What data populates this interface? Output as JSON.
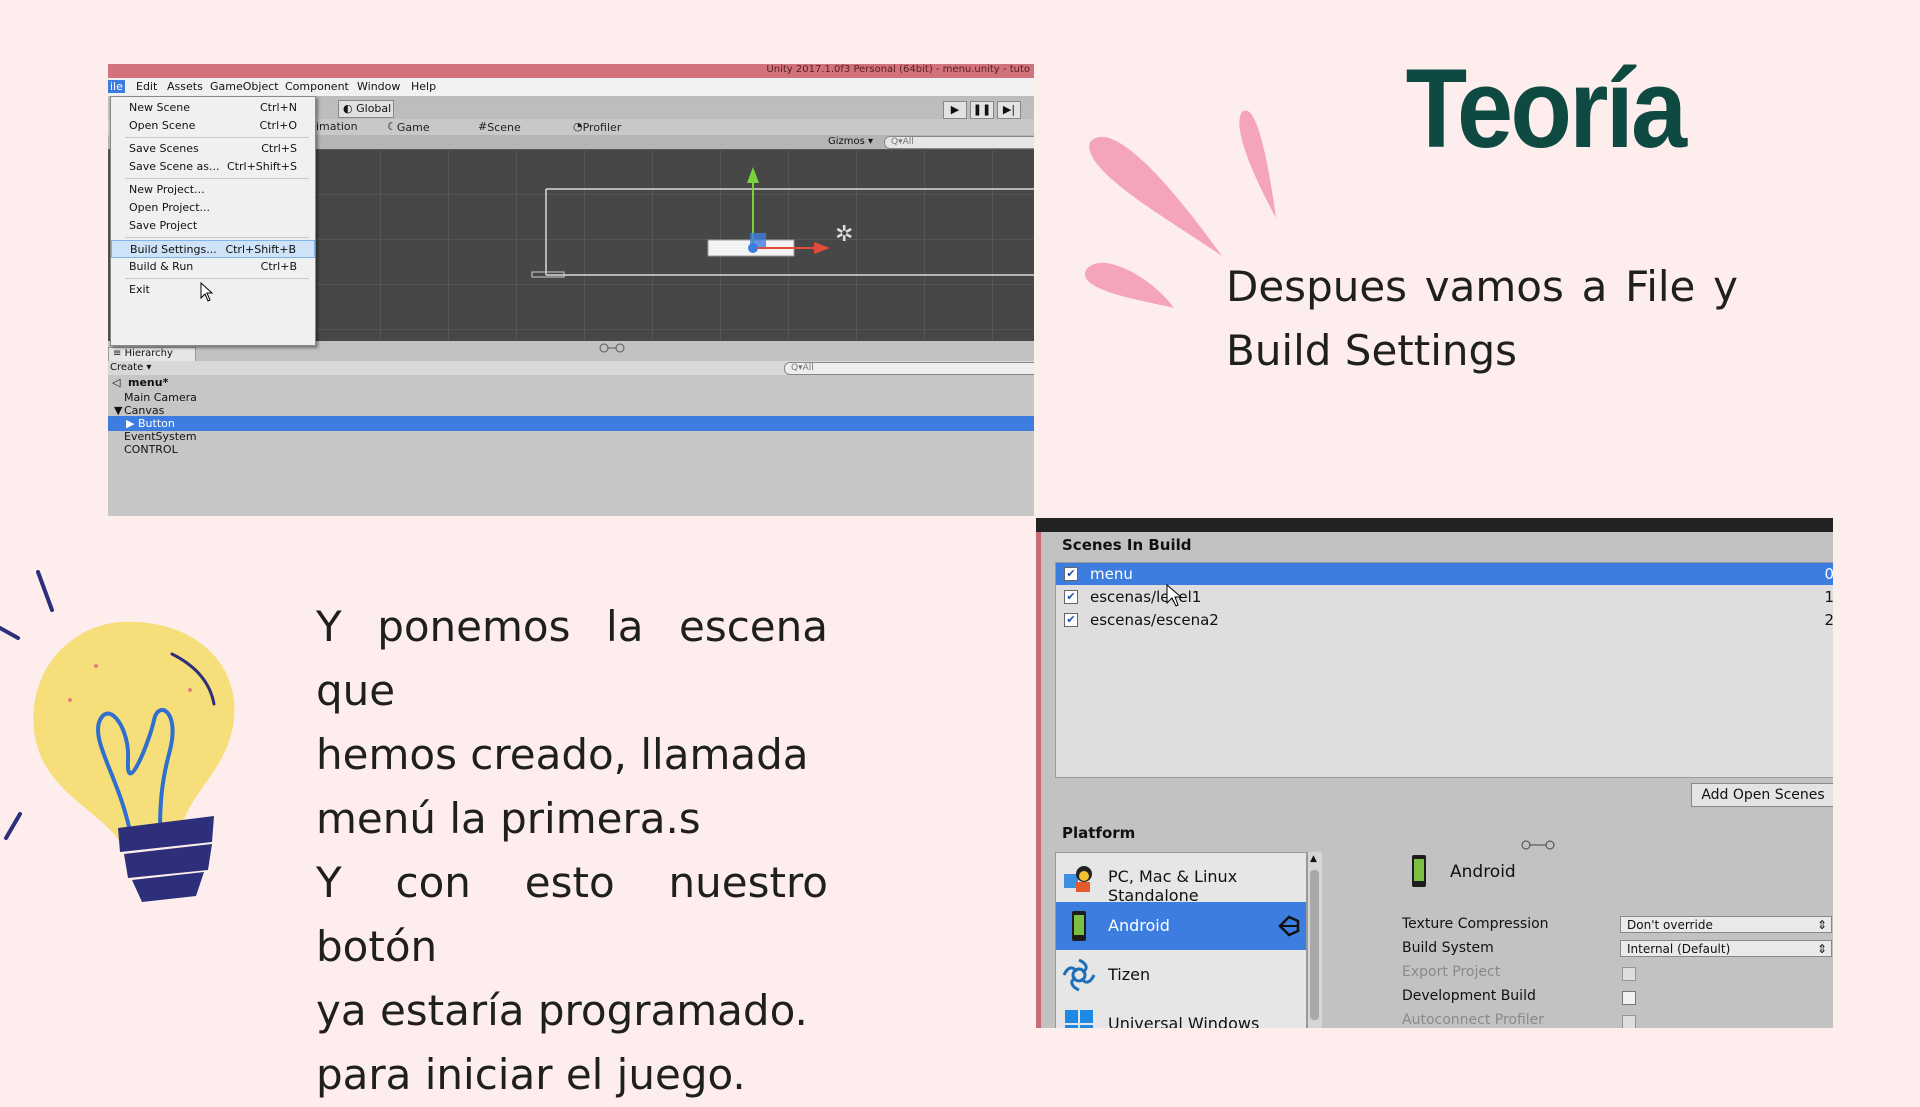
{
  "slide": {
    "title": "Teoría",
    "top_text": "Despues vamos a File y Build Settings",
    "left_lines": [
      "Y ponemos la escena que",
      "hemos creado, llamada",
      "menú la primera.s",
      "Y con esto nuestro botón",
      "ya estaría programado.",
      "para iniciar el juego."
    ]
  },
  "unity": {
    "title": "Unity 2017.1.0f3 Personal (64bit) - menu.unity - tuto",
    "menubar": [
      "ile",
      "Edit",
      "Assets",
      "GameObject",
      "Component",
      "Window",
      "Help"
    ],
    "toolbar_global": "Global",
    "tabs": [
      "imation",
      "Game",
      "Scene",
      "Profiler"
    ],
    "gizmos": "Gizmos",
    "search_placeholder": "All",
    "file_menu": [
      {
        "label": "New Scene",
        "shortcut": "Ctrl+N"
      },
      {
        "label": "Open Scene",
        "shortcut": "Ctrl+O"
      },
      {
        "label": "Save Scenes",
        "shortcut": "Ctrl+S"
      },
      {
        "label": "Save Scene as...",
        "shortcut": "Ctrl+Shift+S"
      },
      {
        "label": "New Project...",
        "shortcut": ""
      },
      {
        "label": "Open Project...",
        "shortcut": ""
      },
      {
        "label": "Save Project",
        "shortcut": ""
      },
      {
        "label": "Build Settings...",
        "shortcut": "Ctrl+Shift+B"
      },
      {
        "label": "Build & Run",
        "shortcut": "Ctrl+B"
      },
      {
        "label": "Exit",
        "shortcut": ""
      }
    ],
    "hierarchy_tab": "Hierarchy",
    "hierarchy_create": "Create",
    "hierarchy_search": "All",
    "hierarchy": [
      "menu*",
      "Main Camera",
      "Canvas",
      "Button",
      "EventSystem",
      "CONTROL"
    ]
  },
  "build": {
    "scenes_heading": "Scenes In Build",
    "scenes": [
      {
        "name": "menu",
        "index": "0"
      },
      {
        "name": "escenas/level1",
        "index": "1"
      },
      {
        "name": "escenas/escena2",
        "index": "2"
      }
    ],
    "add_open_scenes": "Add Open Scenes",
    "platform_heading": "Platform",
    "platforms": [
      "PC, Mac & Linux Standalone",
      "Android",
      "Tizen",
      "Universal Windows Platform"
    ],
    "selected_platform": "Android",
    "settings": {
      "texture_compression_label": "Texture Compression",
      "texture_compression_value": "Don't override",
      "build_system_label": "Build System",
      "build_system_value": "Internal (Default)",
      "export_project_label": "Export Project",
      "development_build_label": "Development Build",
      "autoconnect_profiler_label": "Autoconnect Profiler"
    }
  }
}
